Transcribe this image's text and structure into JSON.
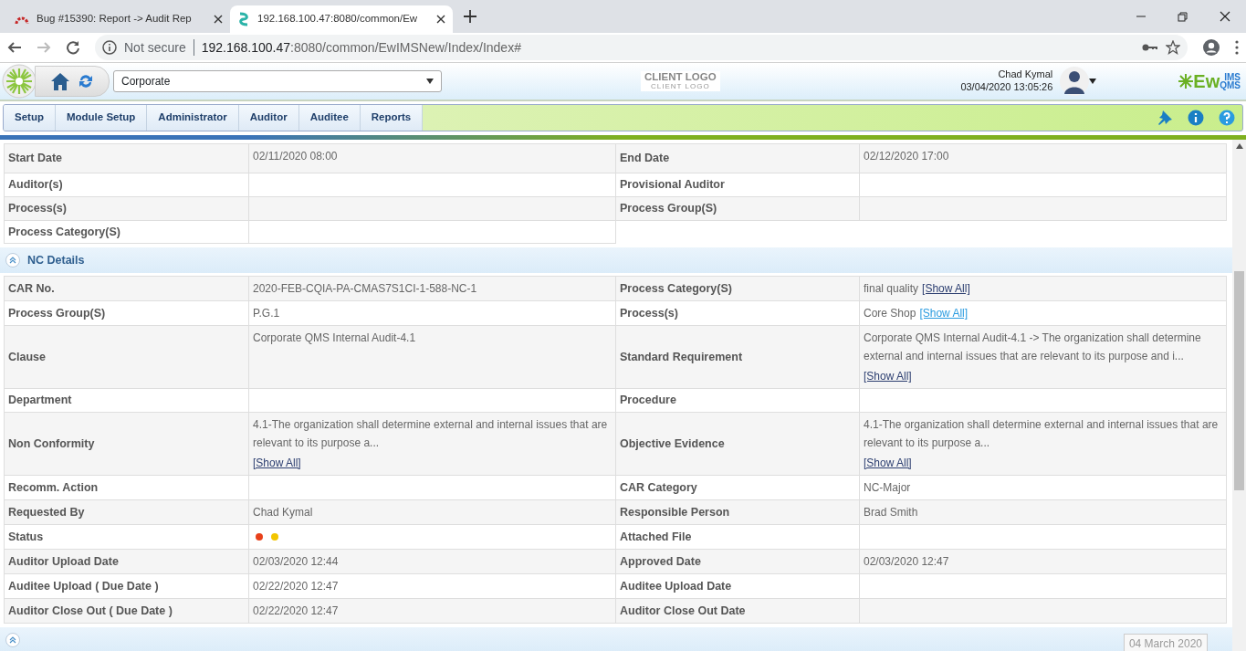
{
  "browser": {
    "tabs": [
      {
        "title": "Bug #15390: Report -> Audit Rep",
        "selected": false
      },
      {
        "title": "192.168.100.47:8080/common/Ew",
        "selected": true
      }
    ],
    "security": "Not secure",
    "url_host": "192.168.100.47",
    "url_rest": ":8080/common/EwIMSNew/Index/Index#"
  },
  "app_header": {
    "site_select": "Corporate",
    "client_logo": "CLIENT LOGO",
    "client_logo_sub": "CLIENT LOGO",
    "user_name": "Chad Kymal",
    "datetime": "03/04/2020 13:05:26",
    "brand": "Ew",
    "brand_sup": "IMS",
    "brand_sub": "QMS"
  },
  "menu": [
    {
      "label": "Setup"
    },
    {
      "label": "Module Setup"
    },
    {
      "label": "Administrator"
    },
    {
      "label": "Auditor"
    },
    {
      "label": "Auditee"
    },
    {
      "label": "Reports"
    }
  ],
  "audit_table": {
    "rows": [
      {
        "label": "Start Date",
        "value": [
          {
            "kind": "text",
            "text": "02/11/2020 08:00"
          }
        ],
        "label2": "End Date",
        "value2": [
          {
            "kind": "text",
            "text": "02/12/2020 17:00"
          }
        ]
      },
      {
        "label": "Auditor(s)",
        "value": [],
        "label2": "Provisional Auditor",
        "value2": []
      },
      {
        "label": "Process(s)",
        "value": [],
        "label2": "Process Group(S)",
        "value2": []
      },
      {
        "label": "Process Category(S)",
        "value": []
      }
    ]
  },
  "nc_section": {
    "title": "NC Details",
    "expanded": true,
    "rows": [
      {
        "label": "CAR No.",
        "value": [
          {
            "kind": "text",
            "text": "2020-FEB-CQIA-PA-CMAS7S1CI-1-588-NC-1"
          }
        ],
        "label2": "Process Category(S)",
        "value2": [
          {
            "kind": "text",
            "text": "final quality"
          },
          {
            "kind": "link",
            "text": "[Show All]",
            "highlighted": false
          }
        ]
      },
      {
        "label": "Process Group(S)",
        "value": [
          {
            "kind": "text",
            "text": "P.G.1"
          }
        ],
        "label2": "Process(s)",
        "value2": [
          {
            "kind": "text",
            "text": "Core Shop"
          },
          {
            "kind": "link",
            "text": "[Show All]",
            "highlighted": true
          }
        ]
      },
      {
        "label": "Clause",
        "value": [
          {
            "kind": "text",
            "text": "Corporate QMS Internal Audit-4.1"
          }
        ],
        "label2": "Standard Requirement",
        "value2": [
          {
            "kind": "text",
            "text": "Corporate QMS Internal Audit-4.1 -> The organization shall determine external and internal issues that are relevant to its purpose and i..."
          },
          {
            "kind": "linkline",
            "text": "[Show All]",
            "highlighted": false
          }
        ]
      },
      {
        "label": "Department",
        "value": [],
        "label2": "Procedure",
        "value2": []
      },
      {
        "label": "Non Conformity",
        "value": [
          {
            "kind": "text",
            "text": "4.1-The organization shall determine external and internal issues that are relevant to its purpose a..."
          },
          {
            "kind": "linkline",
            "text": "[Show All]",
            "highlighted": false
          }
        ],
        "label2": "Objective Evidence",
        "value2": [
          {
            "kind": "text",
            "text": "4.1-The organization shall determine external and internal issues that are relevant to its purpose a..."
          },
          {
            "kind": "linkline",
            "text": "[Show All]",
            "highlighted": false
          }
        ]
      },
      {
        "label": "Recomm. Action",
        "value": [],
        "label2": "CAR Category",
        "value2": [
          {
            "kind": "text",
            "text": "NC-Major"
          }
        ]
      },
      {
        "label": "Requested By",
        "value": [
          {
            "kind": "text",
            "text": "Chad Kymal"
          }
        ],
        "label2": "Responsible Person",
        "value2": [
          {
            "kind": "text",
            "text": "Brad Smith"
          }
        ]
      },
      {
        "label": "Status",
        "value": [
          {
            "kind": "dot",
            "color": "#e8401a"
          },
          {
            "kind": "dot",
            "color": "#f2c500"
          }
        ],
        "label2": "Attached File",
        "value2": []
      },
      {
        "label": "Auditor Upload Date",
        "value": [
          {
            "kind": "text",
            "text": "02/03/2020 12:44"
          }
        ],
        "label2": "Approved Date",
        "value2": [
          {
            "kind": "text",
            "text": "02/03/2020 12:47"
          }
        ]
      },
      {
        "label": "Auditee Upload ( Due Date )",
        "value": [
          {
            "kind": "text",
            "text": "02/22/2020 12:47"
          }
        ],
        "label2": "Auditee Upload Date",
        "value2": []
      },
      {
        "label": "Auditor Close Out ( Due Date )",
        "value": [
          {
            "kind": "text",
            "text": "02/22/2020 12:47"
          }
        ],
        "label2": "Auditor Close Out Date",
        "value2": []
      }
    ]
  },
  "next_section": {
    "expanded": true
  },
  "tooltip": "04 March 2020"
}
